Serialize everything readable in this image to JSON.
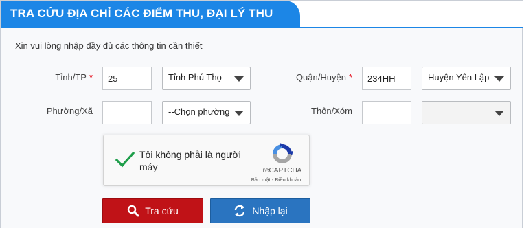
{
  "header": {
    "title": "TRA CỨU ĐỊA CHỈ CÁC ĐIỂM THU, ĐẠI LÝ THU"
  },
  "form": {
    "note": "Xin vui lòng nhập đầy đủ các thông tin cần thiết",
    "required_mark": "*",
    "province": {
      "label": "Tỉnh/TP",
      "code": "25",
      "selected": "Tỉnh Phú Thọ"
    },
    "district": {
      "label": "Quận/Huyện",
      "code": "234HH",
      "selected": "Huyện Yên Lập"
    },
    "ward": {
      "label": "Phường/Xã",
      "code": "",
      "selected": "--Chọn phường/"
    },
    "hamlet": {
      "label": "Thôn/Xóm",
      "code": "",
      "selected": ""
    }
  },
  "captcha": {
    "text": "Tôi không phải là người máy",
    "brand": "reCAPTCHA",
    "links": "Bảo mật - Điều khoản",
    "checked": true
  },
  "buttons": {
    "search": "Tra cứu",
    "reset": "Nhập lại"
  },
  "colors": {
    "accent": "#1c86e6",
    "search_btn": "#c01217",
    "reset_btn": "#2a74c0",
    "required": "#e3000f"
  }
}
